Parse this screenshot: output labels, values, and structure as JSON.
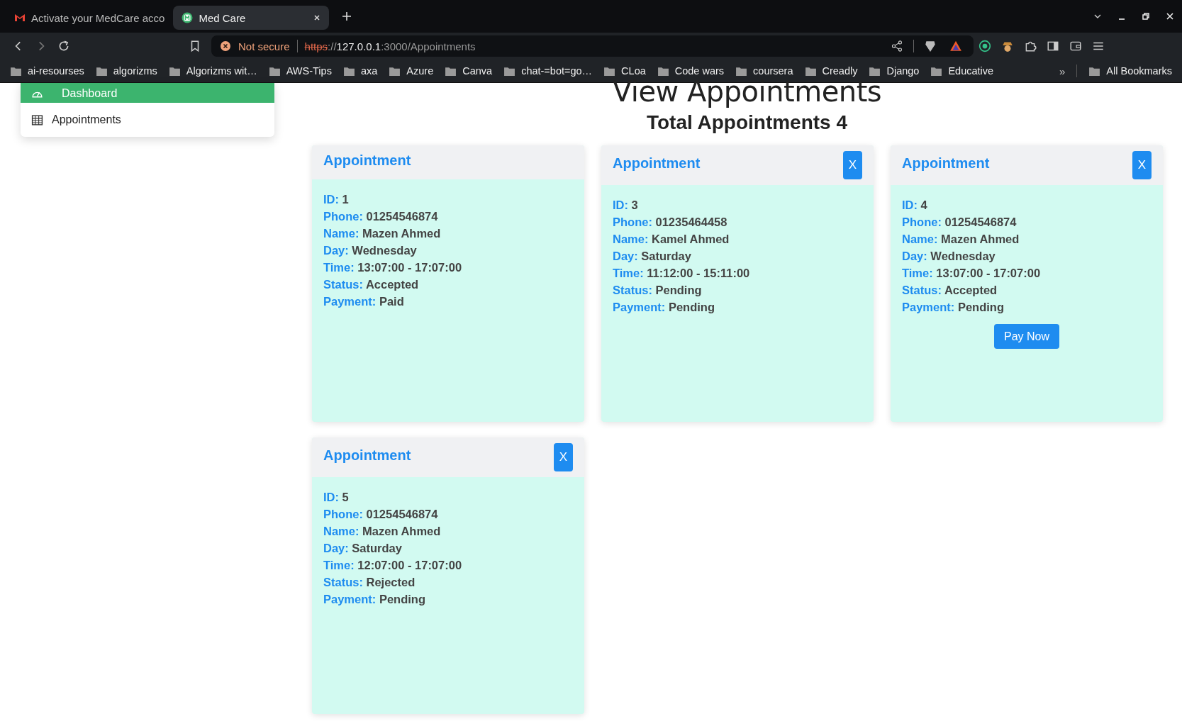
{
  "browser": {
    "tabs": [
      {
        "title": "Activate your MedCare acco",
        "selected": false
      },
      {
        "title": "Med Care",
        "selected": true
      }
    ],
    "security": "Not secure",
    "url_scheme": "https",
    "url_separator": "://",
    "url_host": "127.0.0.1",
    "url_path": ":3000/Appointments",
    "bookmarks": [
      "ai-resourses",
      "algorizms",
      "Algorizms wit…",
      "AWS-Tips",
      "axa",
      "Azure",
      "Canva",
      "chat-=bot=go…",
      "CLoa",
      "Code wars",
      "coursera",
      "Creadly",
      "Django",
      "Educative"
    ],
    "bookmarks_more": "»",
    "all_bookmarks": "All Bookmarks"
  },
  "sidebar": {
    "items": [
      {
        "label": "Dashboard",
        "selected": true
      },
      {
        "label": "Appointments",
        "selected": false
      }
    ]
  },
  "page": {
    "title": "View Appointments",
    "total": "Total Appointments 4"
  },
  "cards": [
    {
      "title": "Appointment",
      "fields": [
        {
          "label": "ID:",
          "value": "1"
        },
        {
          "label": "Phone:",
          "value": "01254546874"
        },
        {
          "label": "Name:",
          "value": "Mazen Ahmed"
        },
        {
          "label": "Day:",
          "value": "Wednesday"
        },
        {
          "label": "Time:",
          "value": "13:07:00 - 17:07:00"
        },
        {
          "label": "Status:",
          "value": "Accepted"
        },
        {
          "label": "Payment:",
          "value": "Paid"
        }
      ]
    },
    {
      "title": "Appointment",
      "delete_button": "X",
      "fields": [
        {
          "label": "ID:",
          "value": "3"
        },
        {
          "label": "Phone:",
          "value": "01235464458"
        },
        {
          "label": "Name:",
          "value": "Kamel Ahmed"
        },
        {
          "label": "Day:",
          "value": "Saturday"
        },
        {
          "label": "Time:",
          "value": "11:12:00 - 15:11:00"
        },
        {
          "label": "Status:",
          "value": "Pending"
        },
        {
          "label": "Payment:",
          "value": "Pending"
        }
      ]
    },
    {
      "title": "Appointment",
      "delete_button": "X",
      "pay_button": "Pay Now",
      "fields": [
        {
          "label": "ID:",
          "value": "4"
        },
        {
          "label": "Phone:",
          "value": "01254546874"
        },
        {
          "label": "Name:",
          "value": "Mazen Ahmed"
        },
        {
          "label": "Day:",
          "value": "Wednesday"
        },
        {
          "label": "Time:",
          "value": "13:07:00 - 17:07:00"
        },
        {
          "label": "Status:",
          "value": "Accepted"
        },
        {
          "label": "Payment:",
          "value": "Pending"
        }
      ]
    },
    {
      "title": "Appointment",
      "delete_button": "X",
      "fields": [
        {
          "label": "ID:",
          "value": "5"
        },
        {
          "label": "Phone:",
          "value": "01254546874"
        },
        {
          "label": "Name:",
          "value": "Mazen Ahmed"
        },
        {
          "label": "Day:",
          "value": "Saturday"
        },
        {
          "label": "Time:",
          "value": "12:07:00 - 17:07:00"
        },
        {
          "label": "Status:",
          "value": "Rejected"
        },
        {
          "label": "Payment:",
          "value": "Pending"
        }
      ]
    }
  ]
}
